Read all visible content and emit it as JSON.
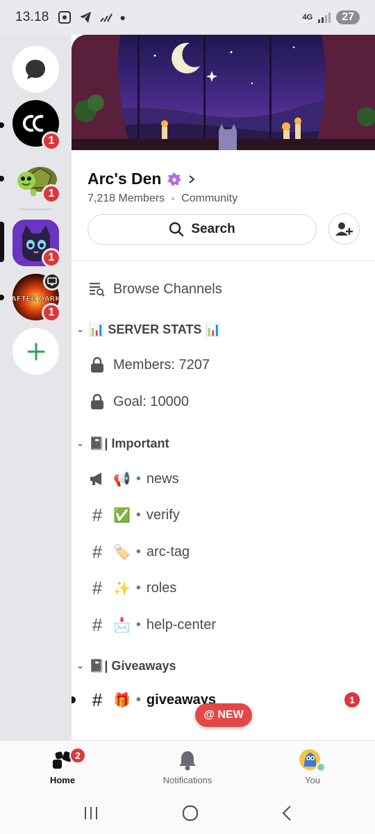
{
  "status_bar": {
    "time": "13.18",
    "network": "4G",
    "battery": "27"
  },
  "rail": {
    "servers": [
      {
        "name": "dm",
        "badge": ""
      },
      {
        "name": "AC",
        "badge": "1"
      },
      {
        "name": "turtle",
        "badge": "1"
      },
      {
        "name": "cat",
        "badge": "1"
      },
      {
        "name": "After Dark",
        "badge": "1"
      }
    ],
    "server_logo_text": "AFTER DARK"
  },
  "server": {
    "name": "Arc's Den",
    "members": "7,218 Members",
    "type": "Community",
    "search_label": "Search"
  },
  "channels": {
    "browse": "Browse Channels",
    "categories": [
      {
        "title": "📊 SERVER STATS 📊",
        "items": [
          {
            "label": "Members: 7207"
          },
          {
            "label": "Goal: 10000"
          }
        ]
      },
      {
        "title": "📓| Important",
        "items": [
          {
            "emoji": "📢",
            "label": "news"
          },
          {
            "emoji": "✅",
            "label": "verify"
          },
          {
            "emoji": "🏷️",
            "label": "arc-tag"
          },
          {
            "emoji": "✨",
            "label": "roles"
          },
          {
            "emoji": "📩",
            "label": "help-center"
          }
        ]
      },
      {
        "title": "📓| Giveaways",
        "items": [
          {
            "emoji": "🎁",
            "label": "giveaways",
            "badge": "1"
          }
        ]
      }
    ],
    "new_pill": "@ NEW",
    "bullet": "•"
  },
  "bottom_nav": {
    "home": "Home",
    "home_badge": "2",
    "notifications": "Notifications",
    "you": "You"
  },
  "colors": {
    "accent_red": "#da373c",
    "add_green": "#23a55a",
    "boost_purple": "#b36bd9"
  }
}
